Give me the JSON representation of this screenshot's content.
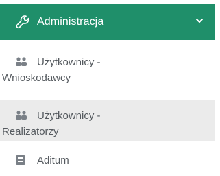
{
  "menu": {
    "header": {
      "label": "Administracja",
      "icon": "wrench-icon",
      "chevron": "chevron-down-icon",
      "bg_color": "#1f8f6a"
    },
    "items": [
      {
        "line1": "Użytkownicy -",
        "line2": "Wnioskodawcy",
        "icon": "users-icon",
        "active": false
      },
      {
        "line1": "Użytkownicy -",
        "line2": "Realizatorzy",
        "icon": "users-icon",
        "active": true
      },
      {
        "line1": "Aditum",
        "line2": "",
        "icon": "id-card-icon",
        "active": false
      }
    ]
  }
}
